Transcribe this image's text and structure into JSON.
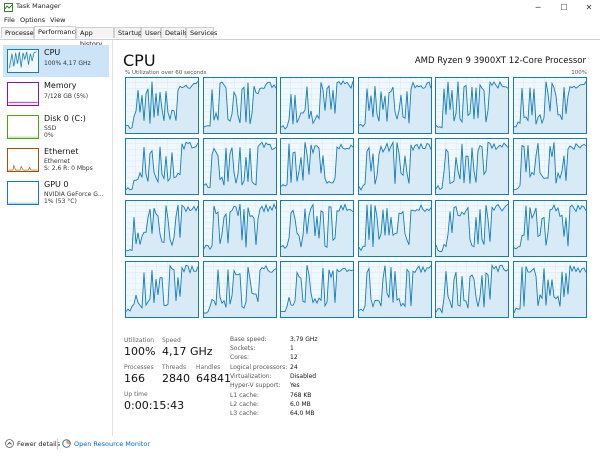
{
  "window": {
    "title": "Task Manager"
  },
  "menu": [
    "File",
    "Options",
    "View"
  ],
  "tabs": [
    {
      "label": "Processes"
    },
    {
      "label": "Performance"
    },
    {
      "label": "App history"
    },
    {
      "label": "Startup"
    },
    {
      "label": "Users"
    },
    {
      "label": "Details"
    },
    {
      "label": "Services"
    }
  ],
  "active_tab": "Performance",
  "sidebar": {
    "items": [
      {
        "title": "CPU",
        "lines": [
          "100% 4,17 GHz"
        ],
        "color": "#117dbb"
      },
      {
        "title": "Memory",
        "lines": [
          "7/128 GB (5%)"
        ],
        "color": "#8b12ae"
      },
      {
        "title": "Disk 0 (C:)",
        "lines": [
          "SSD",
          "0%"
        ],
        "color": "#4da60c"
      },
      {
        "title": "Ethernet",
        "lines": [
          "Ethernet",
          "S: 2,6 R: 0 Mbps"
        ],
        "color": "#a74f01"
      },
      {
        "title": "GPU 0",
        "lines": [
          "NVIDIA GeForce G...",
          "1% (53 °C)"
        ],
        "color": "#117dbb"
      }
    ]
  },
  "main": {
    "title": "CPU",
    "processor": "AMD Ryzen 9 3900XT 12-Core Processor",
    "util_label": "% Utilization over 60 seconds",
    "util_max": "100%",
    "graph_color": "#117dbb",
    "logical_processor_graphs": 24
  },
  "stats": {
    "utilization": {
      "label": "Utilization",
      "value": "100%"
    },
    "speed": {
      "label": "Speed",
      "value": "4,17 GHz"
    },
    "processes": {
      "label": "Processes",
      "value": "166"
    },
    "threads": {
      "label": "Threads",
      "value": "2840"
    },
    "handles": {
      "label": "Handles",
      "value": "64841"
    },
    "uptime": {
      "label": "Up time",
      "value": "0:00:15:43"
    }
  },
  "specs": [
    {
      "label": "Base speed:",
      "value": "3,79 GHz"
    },
    {
      "label": "Sockets:",
      "value": "1"
    },
    {
      "label": "Cores:",
      "value": "12"
    },
    {
      "label": "Logical processors:",
      "value": "24"
    },
    {
      "label": "Virtualization:",
      "value": "Disabled"
    },
    {
      "label": "Hyper-V support:",
      "value": "Yes"
    },
    {
      "label": "L1 cache:",
      "value": "768 KB"
    },
    {
      "label": "L2 cache:",
      "value": "6,0 MB"
    },
    {
      "label": "L3 cache:",
      "value": "64,0 MB"
    }
  ],
  "footer": {
    "fewer_details": "Fewer details",
    "open_resource_monitor": "Open Resource Monitor",
    "link_color": "#0066cc"
  }
}
